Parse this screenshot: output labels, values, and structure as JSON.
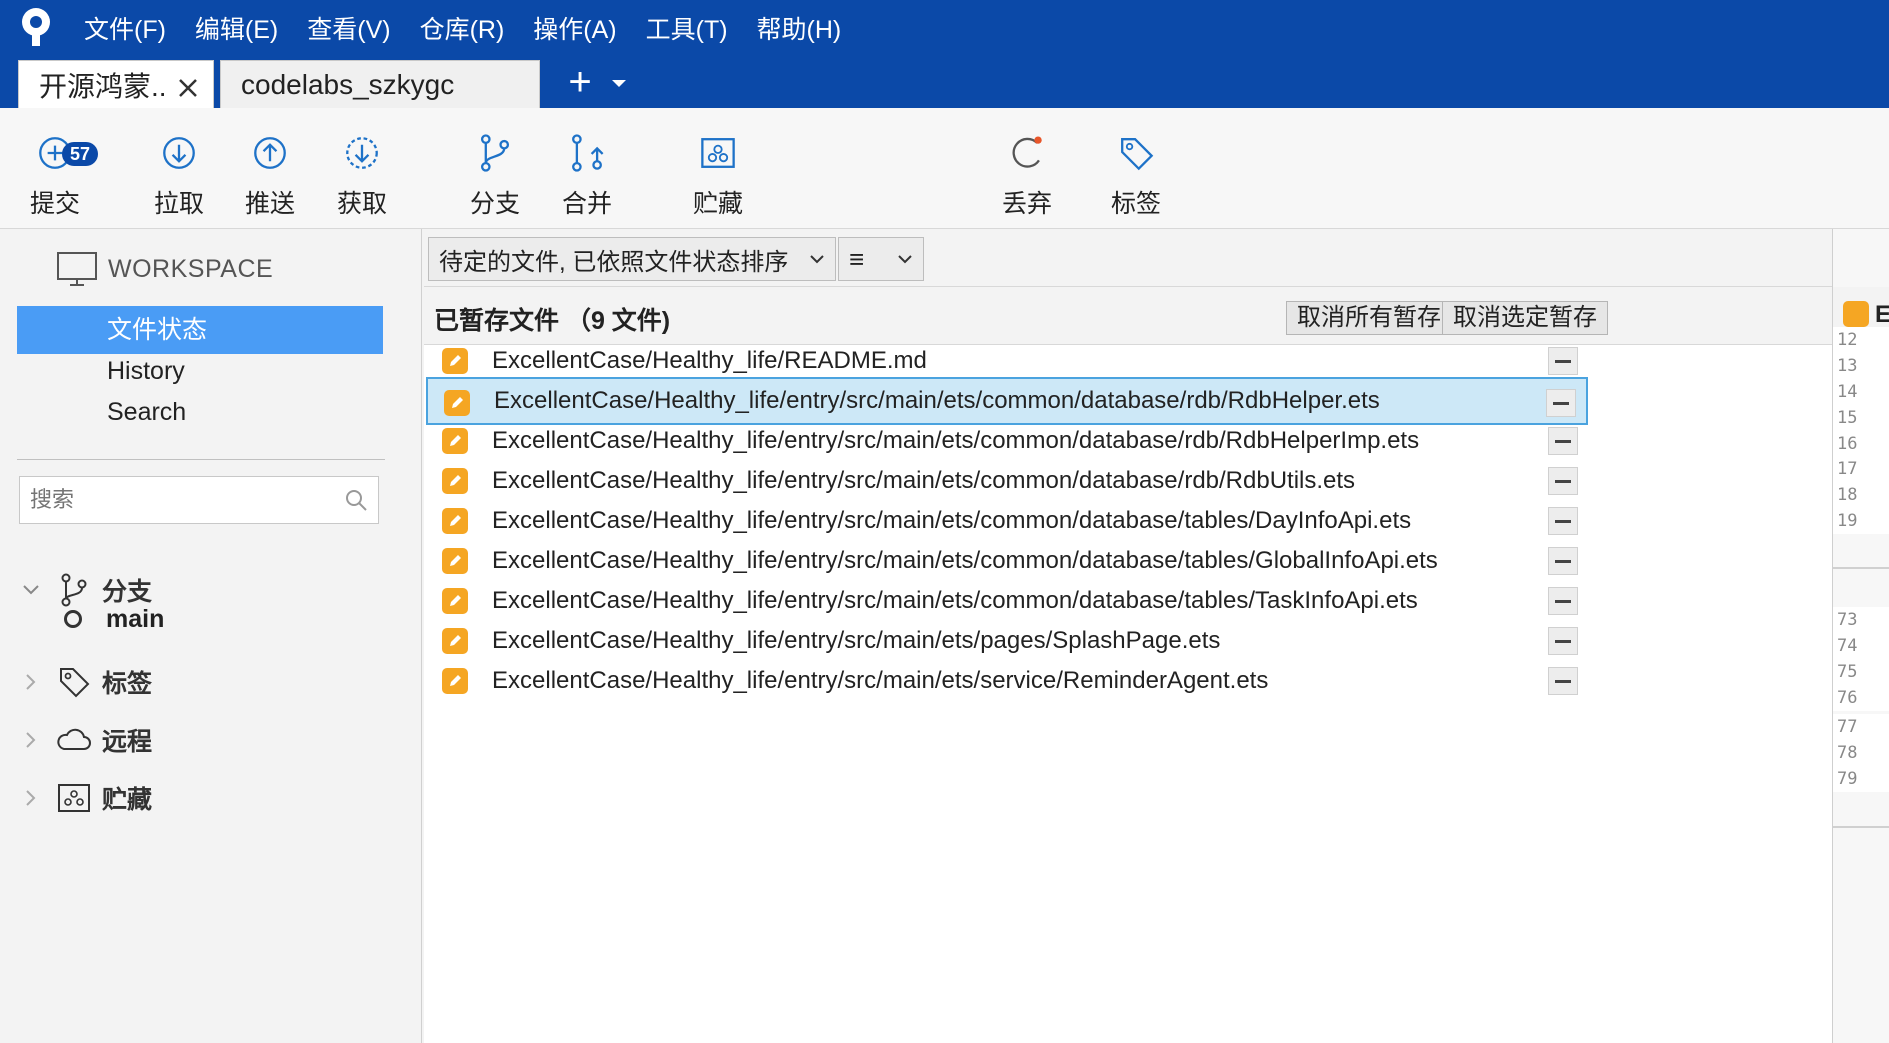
{
  "menu": {
    "items": [
      "文件(F)",
      "编辑(E)",
      "查看(V)",
      "仓库(R)",
      "操作(A)",
      "工具(T)",
      "帮助(H)"
    ]
  },
  "tabs": {
    "active": "开源鸿蒙...",
    "inactive": "codelabs_szkygc",
    "add": "+"
  },
  "toolbar": {
    "commit": "提交",
    "commit_badge": "57",
    "pull": "拉取",
    "push": "推送",
    "fetch": "获取",
    "branch": "分支",
    "merge": "合并",
    "stash": "贮藏",
    "discard": "丢弃",
    "tag": "标签"
  },
  "sidebar": {
    "workspace": "WORKSPACE",
    "nav": [
      "文件状态",
      "History",
      "Search"
    ],
    "search_placeholder": "搜索",
    "branches": "分支",
    "current_branch": "main",
    "tags": "标签",
    "remotes": "远程",
    "stashes": "贮藏"
  },
  "filter": {
    "sort_label": "待定的文件, 已依照文件状态排序",
    "view_icon": "≡"
  },
  "staged": {
    "title": "已暂存文件 （9 文件)",
    "unstage_all": "取消所有暂存",
    "unstage_selected": "取消选定暂存",
    "files": [
      "ExcellentCase/Healthy_life/README.md",
      "ExcellentCase/Healthy_life/entry/src/main/ets/common/database/rdb/RdbHelper.ets",
      "ExcellentCase/Healthy_life/entry/src/main/ets/common/database/rdb/RdbHelperImp.ets",
      "ExcellentCase/Healthy_life/entry/src/main/ets/common/database/rdb/RdbUtils.ets",
      "ExcellentCase/Healthy_life/entry/src/main/ets/common/database/tables/DayInfoApi.ets",
      "ExcellentCase/Healthy_life/entry/src/main/ets/common/database/tables/GlobalInfoApi.ets",
      "ExcellentCase/Healthy_life/entry/src/main/ets/common/database/tables/TaskInfoApi.ets",
      "ExcellentCase/Healthy_life/entry/src/main/ets/pages/SplashPage.ets",
      "ExcellentCase/Healthy_life/entry/src/main/ets/service/ReminderAgent.ets"
    ],
    "selected_index": 1
  },
  "diff": {
    "header_letter": "E",
    "hunk1": [
      "12",
      "13",
      "14",
      "15",
      "16"
    ],
    "hunk1b": [
      "17",
      "18",
      "19"
    ],
    "hunk2": [
      "73",
      "74",
      "75",
      "76"
    ],
    "hunk2b": [
      "77",
      "78",
      "79"
    ]
  },
  "colors": {
    "titlebar": "#0b49a8",
    "selection": "#4a9cf5",
    "file_modified": "#f5a623",
    "row_selected": "#cde8f7"
  }
}
